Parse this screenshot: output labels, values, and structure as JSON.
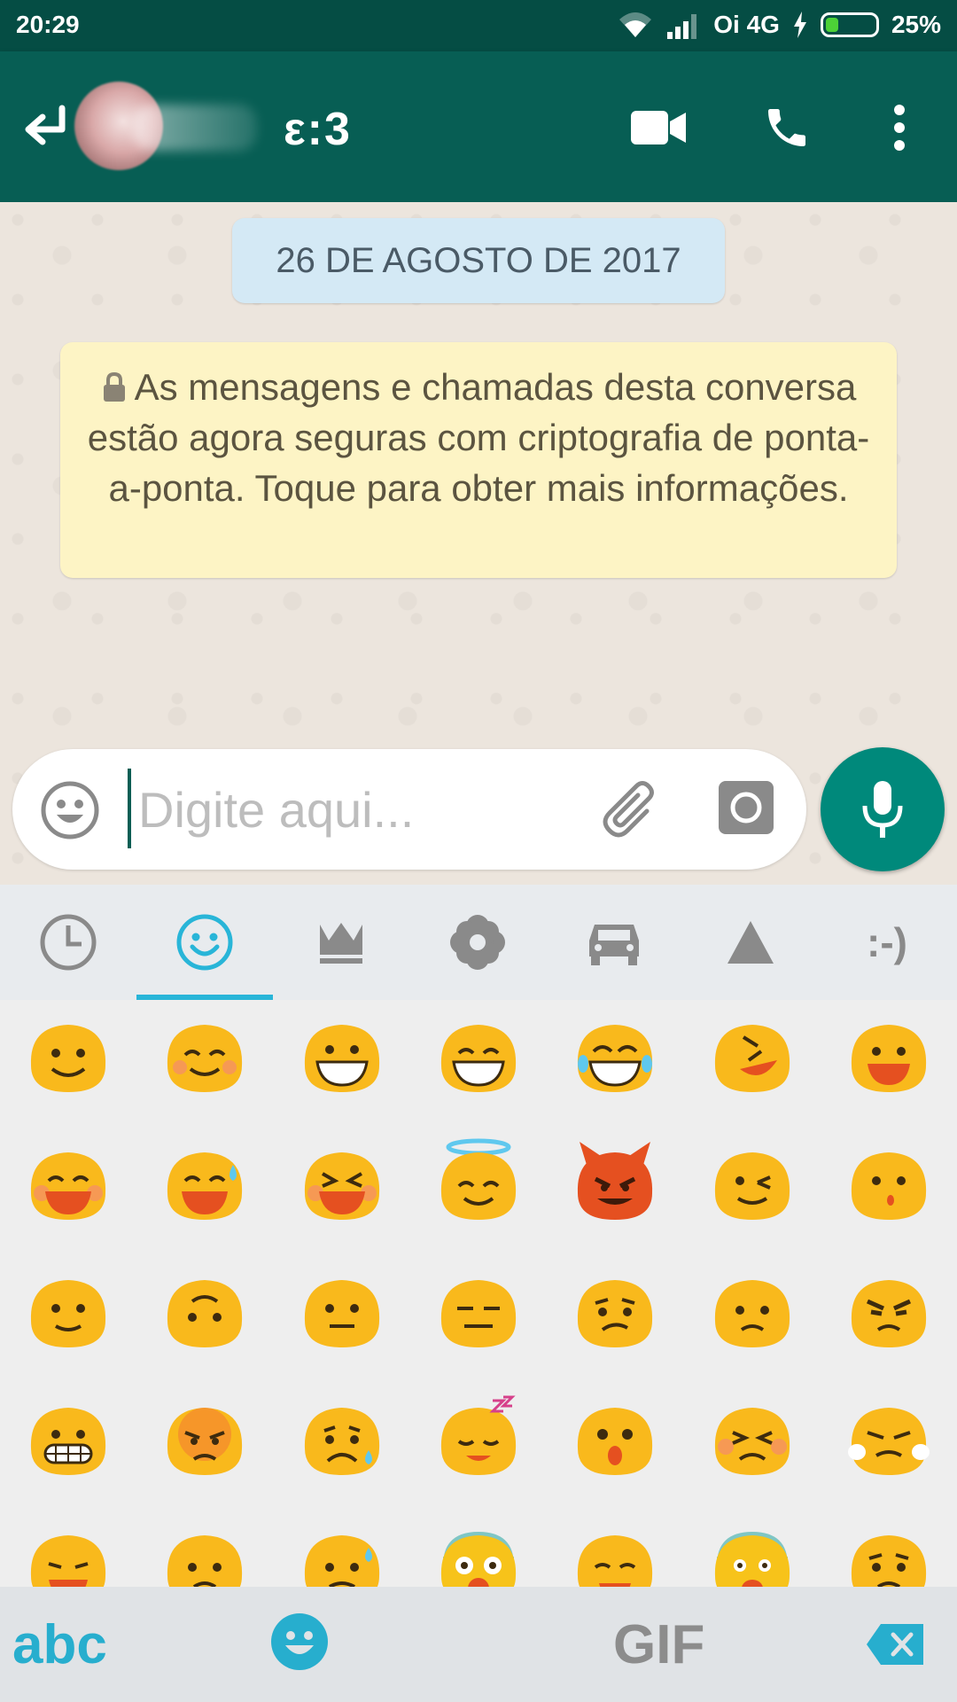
{
  "status_bar": {
    "time": "20:29",
    "carrier": "Oi 4G",
    "battery": "25%",
    "battery_level": 0.25
  },
  "header": {
    "contact_name": "ε:3",
    "icons": [
      "back-arrow-icon",
      "avatar",
      "video-call-icon",
      "phone-call-icon",
      "more-vert-icon"
    ]
  },
  "chat": {
    "date_chip": "26 DE AGOSTO DE 2017",
    "encryption_notice": "As mensagens e chamadas desta conversa estão agora seguras com criptografia de ponta-a-ponta. Toque para obter mais informações."
  },
  "composer": {
    "placeholder": "Digite aqui..."
  },
  "emoji_keyboard": {
    "tabs": [
      {
        "name": "recent",
        "icon": "clock-icon"
      },
      {
        "name": "smileys",
        "icon": "smiley-icon",
        "active": true
      },
      {
        "name": "crown",
        "icon": "crown-icon"
      },
      {
        "name": "flower",
        "icon": "flower-icon"
      },
      {
        "name": "car",
        "icon": "car-icon"
      },
      {
        "name": "symbols",
        "icon": "triangle-icon"
      },
      {
        "name": "emoticons",
        "label": ":-)"
      }
    ],
    "bottom": {
      "abc_label": "abc",
      "gif_label": "GIF"
    },
    "accent_color": "#28b5d8"
  },
  "colors": {
    "status_bar": "#054d44",
    "app_bar": "#075e54",
    "fab": "#00897b",
    "date_chip": "#d4e9f5",
    "notice": "#fdf4c5"
  }
}
